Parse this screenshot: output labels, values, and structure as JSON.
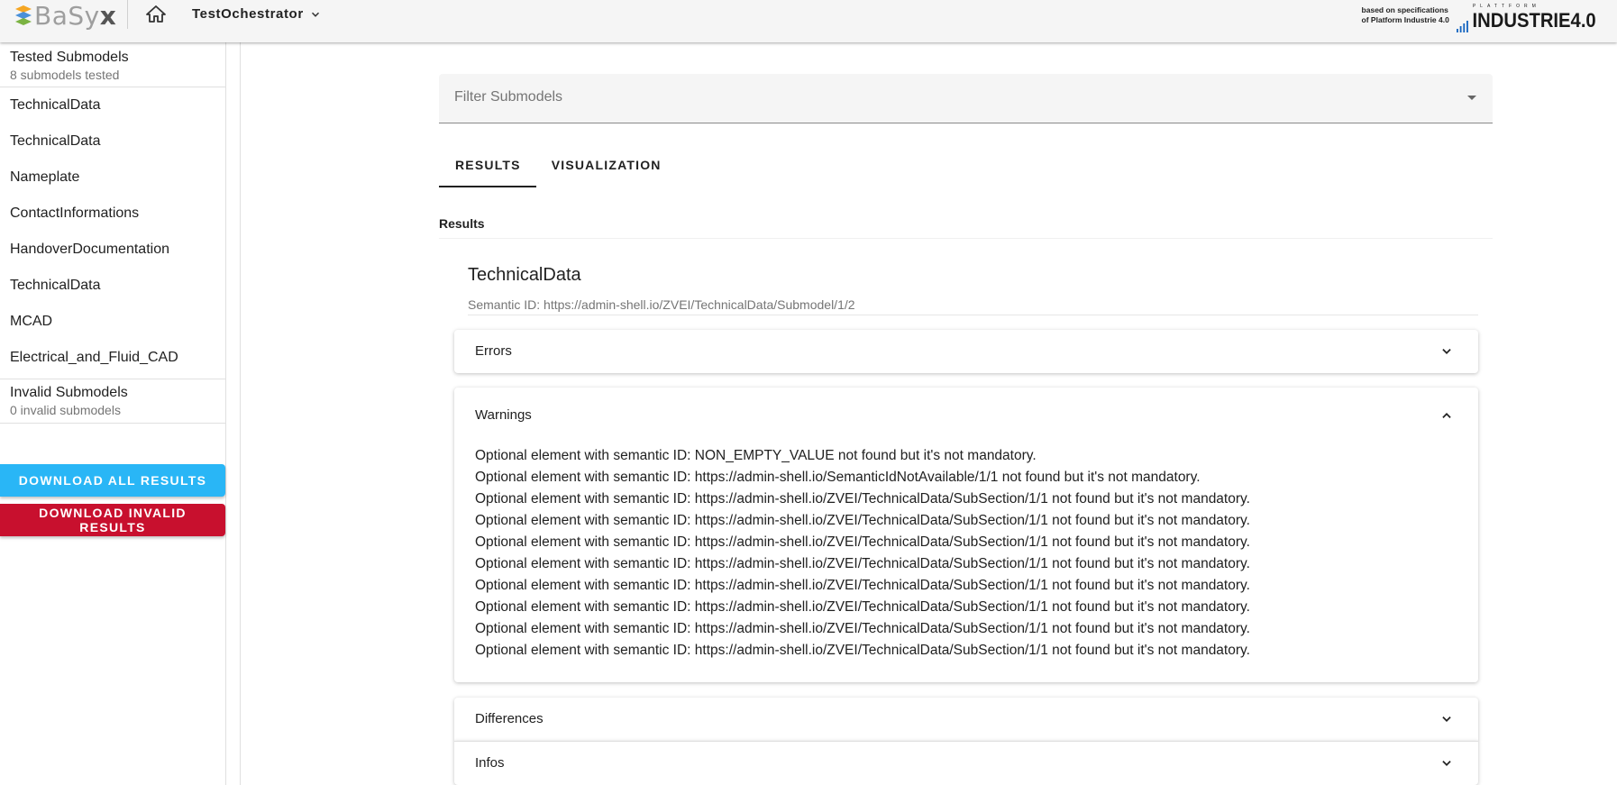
{
  "header": {
    "logo_text_main": "BaSy",
    "logo_text_x": "x",
    "app_title": "TestOchestrator",
    "i40_line1": "based on specifications",
    "i40_line2": "of Platform Industrie 4.0",
    "i40_platform": "PLATTFORM",
    "i40_brand": "INDUSTRIE4.0"
  },
  "sidebar": {
    "tested_title": "Tested Submodels",
    "tested_count": "8 submodels tested",
    "items": [
      {
        "label": "TechnicalData"
      },
      {
        "label": "TechnicalData"
      },
      {
        "label": "Nameplate"
      },
      {
        "label": "ContactInformations"
      },
      {
        "label": "HandoverDocumentation"
      },
      {
        "label": "TechnicalData"
      },
      {
        "label": "MCAD"
      },
      {
        "label": "Electrical_and_Fluid_CAD"
      }
    ],
    "invalid_title": "Invalid Submodels",
    "invalid_count": "0 invalid submodels",
    "download_all": "DOWNLOAD ALL RESULTS",
    "download_invalid": "DOWNLOAD INVALID RESULTS"
  },
  "main": {
    "filter_placeholder": "Filter Submodels",
    "tabs": [
      {
        "label": "RESULTS",
        "active": true
      },
      {
        "label": "VISUALIZATION",
        "active": false
      }
    ],
    "results_label": "Results",
    "submodel_title": "TechnicalData",
    "semantic_id": "Semantic ID: https://admin-shell.io/ZVEI/TechnicalData/Submodel/1/2",
    "panels": {
      "errors": "Errors",
      "warnings": "Warnings",
      "differences": "Differences",
      "infos": "Infos"
    },
    "warnings": [
      "Optional element with semantic ID: NON_EMPTY_VALUE not found but it's not mandatory.",
      "Optional element with semantic ID: https://admin-shell.io/SemanticIdNotAvailable/1/1 not found but it's not mandatory.",
      "Optional element with semantic ID: https://admin-shell.io/ZVEI/TechnicalData/SubSection/1/1 not found but it's not mandatory.",
      "Optional element with semantic ID: https://admin-shell.io/ZVEI/TechnicalData/SubSection/1/1 not found but it's not mandatory.",
      "Optional element with semantic ID: https://admin-shell.io/ZVEI/TechnicalData/SubSection/1/1 not found but it's not mandatory.",
      "Optional element with semantic ID: https://admin-shell.io/ZVEI/TechnicalData/SubSection/1/1 not found but it's not mandatory.",
      "Optional element with semantic ID: https://admin-shell.io/ZVEI/TechnicalData/SubSection/1/1 not found but it's not mandatory.",
      "Optional element with semantic ID: https://admin-shell.io/ZVEI/TechnicalData/SubSection/1/1 not found but it's not mandatory.",
      "Optional element with semantic ID: https://admin-shell.io/ZVEI/TechnicalData/SubSection/1/1 not found but it's not mandatory.",
      "Optional element with semantic ID: https://admin-shell.io/ZVEI/TechnicalData/SubSection/1/1 not found but it's not mandatory."
    ]
  },
  "colors": {
    "primary_button": "#29b6f6",
    "danger_button": "#c8102e",
    "topbar": "#f5f5f5"
  },
  "icons": {
    "home": "home-icon",
    "app_dropdown": "chevron-down-icon",
    "filter_dropdown": "arrow-drop-down-icon",
    "expand": "chevron-down-icon",
    "collapse": "chevron-up-icon"
  }
}
